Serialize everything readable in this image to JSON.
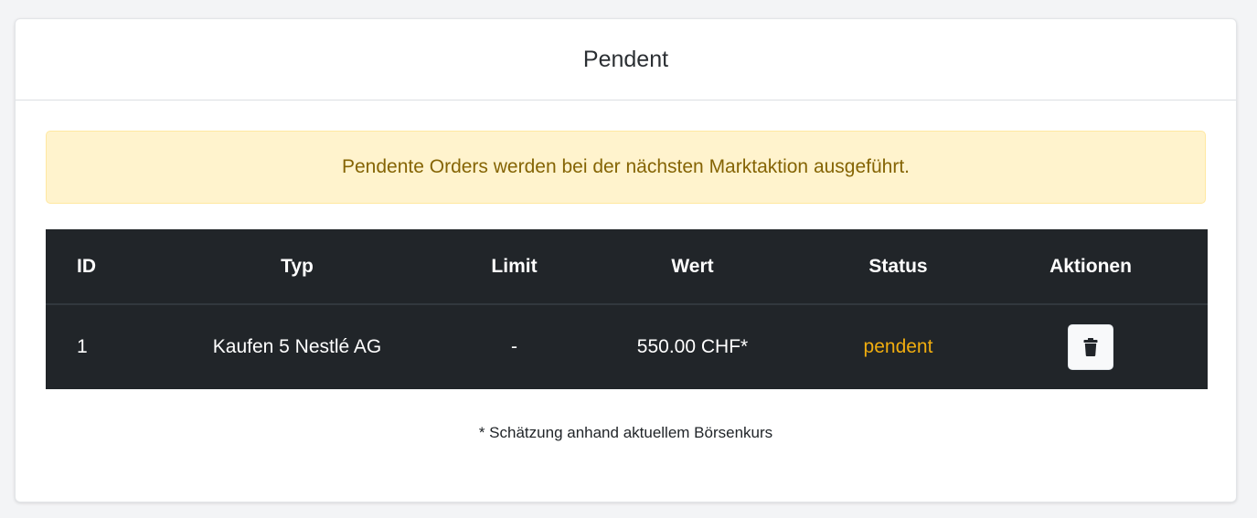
{
  "card": {
    "title": "Pendent"
  },
  "alert": {
    "text": "Pendente Orders werden bei der nächsten Marktaktion ausgeführt."
  },
  "table": {
    "headers": {
      "id": "ID",
      "typ": "Typ",
      "limit": "Limit",
      "wert": "Wert",
      "status": "Status",
      "aktionen": "Aktionen"
    },
    "rows": [
      {
        "id": "1",
        "typ": "Kaufen 5 Nestlé AG",
        "limit": "-",
        "wert": "550.00 CHF*",
        "status": "pendent",
        "action_icon": "trash-icon"
      }
    ]
  },
  "footnote": "* Schätzung anhand aktuellem Börsenkurs",
  "colors": {
    "alert_bg": "#fff3cd",
    "alert_text": "#856404",
    "table_bg": "#212529",
    "status_pending": "#f0ad0f"
  }
}
